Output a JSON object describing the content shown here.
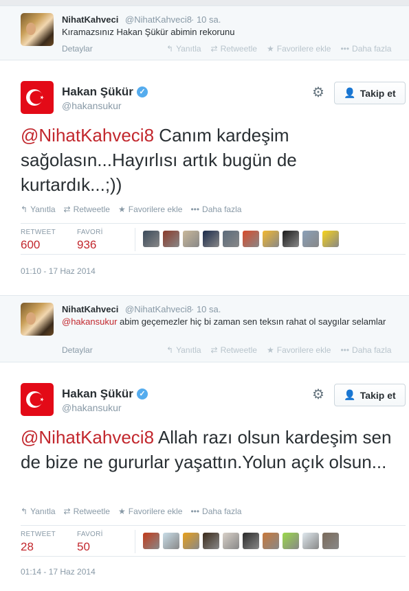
{
  "reply1": {
    "name": "NihatKahveci",
    "handle": "@NihatKahveci8",
    "time": "· 10 sa.",
    "text": "Kıramazsınız Hakan Şükür abimin rekorunu",
    "details": "Detaylar",
    "actions": [
      "Yanıtla",
      "Retweetle",
      "Favorilere ekle",
      "Daha fazla"
    ]
  },
  "tweet1": {
    "name": "Hakan Şükür",
    "handle": "@hakansukur",
    "follow": "Takip et",
    "mention": "@NihatKahveci8",
    "text": " Canım kardeşim sağolasın...Hayırlısı artık bugün de kurtardık...;))",
    "actions": [
      "Yanıtla",
      "Retweetle",
      "Favorilere ekle",
      "Daha fazla"
    ],
    "retweet_label": "RETWEET",
    "retweet_count": "600",
    "fav_label": "FAVORİ",
    "fav_count": "936",
    "date": "01:10 - 17 Haz 2014",
    "favoriters": [
      "#3b4a5a",
      "#8a3a2a",
      "#c9b89a",
      "#1a2a4a",
      "#5a6a7a",
      "#d84a2a",
      "#f2b830",
      "#1a1a1a",
      "#8aa0b8",
      "#f7d31a"
    ]
  },
  "reply2": {
    "name": "NihatKahveci",
    "handle": "@NihatKahveci8",
    "time": "· 10 sa.",
    "mention": "@hakansukur",
    "text": " abim geçemezler hiç bi zaman sen teksın rahat ol saygılar selamlar",
    "details": "Detaylar",
    "actions": [
      "Yanıtla",
      "Retweetle",
      "Favorilere ekle",
      "Daha fazla"
    ]
  },
  "tweet2": {
    "name": "Hakan Şükür",
    "handle": "@hakansukur",
    "follow": "Takip et",
    "mention": "@NihatKahveci8",
    "text": " Allah razı olsun kardeşim sen de bize ne gururlar yaşattın.Yolun açık olsun...",
    "actions": [
      "Yanıtla",
      "Retweetle",
      "Favorilere ekle",
      "Daha fazla"
    ],
    "retweet_label": "RETWEET",
    "retweet_count": "28",
    "fav_label": "FAVORİ",
    "fav_count": "50",
    "date": "01:14 - 17 Haz 2014",
    "favoriters": [
      "#c23a1a",
      "#c8dde8",
      "#e8a01a",
      "#3a2a1a",
      "#d8d0c8",
      "#2a2a2a",
      "#c8783a",
      "#9ad84a",
      "#dfe8ee",
      "#7a6a5a"
    ]
  },
  "colors": {
    "link": "#c2272d",
    "verified": "#55acee",
    "flag_red": "#e30a17"
  }
}
